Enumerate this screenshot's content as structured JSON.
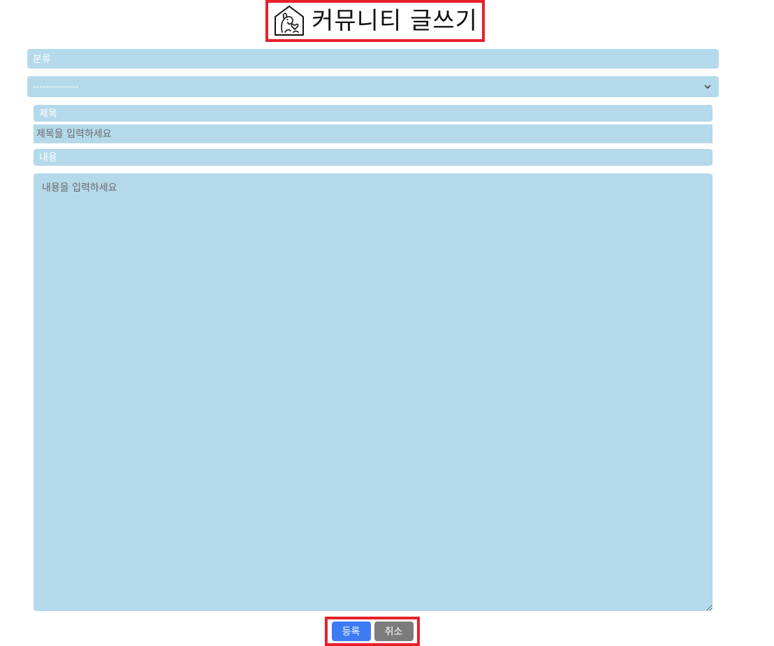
{
  "header": {
    "title": "커뮤니티 글쓰기",
    "logo_icon": "dog-house-heart-icon"
  },
  "form": {
    "category_label": "분류",
    "category_selected": "--------------",
    "subject_label": "제목",
    "subject_placeholder": "제목을 입력하세요",
    "subject_value": "",
    "content_label": "내용",
    "content_placeholder": "내용을 입력하세요",
    "content_value": ""
  },
  "actions": {
    "submit_label": "등록",
    "cancel_label": "취소"
  },
  "colors": {
    "field_bg": "#b4d9ea",
    "highlight_border": "#e8202a",
    "submit_bg": "#3d7bf5",
    "cancel_bg": "#7c7c7c"
  }
}
